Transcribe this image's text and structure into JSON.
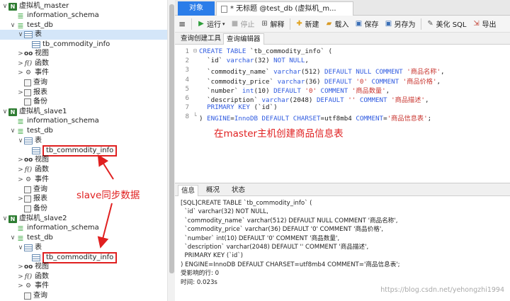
{
  "tree": {
    "items": [
      {
        "label": "虚拟机_master",
        "icon": "connection-icon",
        "chev": "∨"
      },
      {
        "label": "information_schema",
        "icon": "database-icon",
        "chev": ""
      },
      {
        "label": "test_db",
        "icon": "database-icon",
        "chev": "∨"
      },
      {
        "label": "表",
        "icon": "tables-icon",
        "chev": "∨"
      },
      {
        "label": "tb_commodity_info",
        "icon": "table-icon",
        "chev": ""
      },
      {
        "label": "视图",
        "icon": "view-icon",
        "chev": ">"
      },
      {
        "label": "函数",
        "icon": "function-icon",
        "chev": ">"
      },
      {
        "label": "事件",
        "icon": "event-icon",
        "chev": ">"
      },
      {
        "label": "查询",
        "icon": "query-icon",
        "chev": ""
      },
      {
        "label": "报表",
        "icon": "report-icon",
        "chev": ">"
      },
      {
        "label": "备份",
        "icon": "backup-icon",
        "chev": ""
      },
      {
        "label": "虚拟机_slave1",
        "icon": "connection-icon",
        "chev": "∨"
      },
      {
        "label": "information_schema",
        "icon": "database-icon",
        "chev": ""
      },
      {
        "label": "test_db",
        "icon": "database-icon",
        "chev": "∨"
      },
      {
        "label": "表",
        "icon": "tables-icon",
        "chev": "∨"
      },
      {
        "label": "tb_commodity_info",
        "icon": "table-icon",
        "chev": ""
      },
      {
        "label": "视图",
        "icon": "view-icon",
        "chev": ">"
      },
      {
        "label": "函数",
        "icon": "function-icon",
        "chev": ">"
      },
      {
        "label": "事件",
        "icon": "event-icon",
        "chev": ">"
      },
      {
        "label": "查询",
        "icon": "query-icon",
        "chev": ""
      },
      {
        "label": "报表",
        "icon": "report-icon",
        "chev": ">"
      },
      {
        "label": "备份",
        "icon": "backup-icon",
        "chev": ""
      },
      {
        "label": "虚拟机_slave2",
        "icon": "connection-icon",
        "chev": "∨"
      },
      {
        "label": "information_schema",
        "icon": "database-icon",
        "chev": ""
      },
      {
        "label": "test_db",
        "icon": "database-icon",
        "chev": "∨"
      },
      {
        "label": "表",
        "icon": "tables-icon",
        "chev": "∨"
      },
      {
        "label": "tb_commodity_info",
        "icon": "table-icon",
        "chev": ""
      },
      {
        "label": "视图",
        "icon": "view-icon",
        "chev": ">"
      },
      {
        "label": "函数",
        "icon": "function-icon",
        "chev": ">"
      },
      {
        "label": "事件",
        "icon": "event-icon",
        "chev": ">"
      },
      {
        "label": "查询",
        "icon": "query-icon",
        "chev": ""
      }
    ]
  },
  "annotations": {
    "slave_sync": "slave同步数据",
    "master_create": "在master主机创建商品信息表"
  },
  "tabs": {
    "object": "对象",
    "query": "* 无标题 @test_db (虚拟机_m..."
  },
  "toolbar": {
    "run": "运行",
    "stop": "停止",
    "explain": "解释",
    "new": "新建",
    "load": "载入",
    "save": "保存",
    "save_as": "另存为",
    "beautify": "美化 SQL",
    "export": "导出"
  },
  "subtabs": {
    "builder": "查询创建工具",
    "editor": "查询编辑器"
  },
  "code_lines": [
    {
      "n": "1",
      "tokens": [
        [
          "kw",
          "CREATE TABLE "
        ],
        [
          "id",
          "`tb_commodity_info` ("
        ]
      ]
    },
    {
      "n": "2",
      "tokens": [
        [
          "id",
          "  `id` "
        ],
        [
          "kw",
          "varchar"
        ],
        [
          "id",
          "(32) "
        ],
        [
          "kw",
          "NOT NULL"
        ],
        [
          "id",
          ","
        ]
      ]
    },
    {
      "n": "3",
      "tokens": [
        [
          "id",
          "  `commodity_name` "
        ],
        [
          "kw",
          "varchar"
        ],
        [
          "id",
          "(512) "
        ],
        [
          "kw",
          "DEFAULT NULL COMMENT "
        ],
        [
          "str",
          "'商品名称'"
        ],
        [
          "id",
          ","
        ]
      ]
    },
    {
      "n": "4",
      "tokens": [
        [
          "id",
          "  `commodity_price` "
        ],
        [
          "kw",
          "varchar"
        ],
        [
          "id",
          "(36) "
        ],
        [
          "kw",
          "DEFAULT "
        ],
        [
          "str",
          "'0' "
        ],
        [
          "kw",
          "COMMENT "
        ],
        [
          "str",
          "'商品价格'"
        ],
        [
          "id",
          ","
        ]
      ]
    },
    {
      "n": "5",
      "tokens": [
        [
          "id",
          "  `number` "
        ],
        [
          "kw",
          "int"
        ],
        [
          "id",
          "(10) "
        ],
        [
          "kw",
          "DEFAULT "
        ],
        [
          "str",
          "'0' "
        ],
        [
          "kw",
          "COMMENT "
        ],
        [
          "str",
          "'商品数量'"
        ],
        [
          "id",
          ","
        ]
      ]
    },
    {
      "n": "6",
      "tokens": [
        [
          "id",
          "  `description` "
        ],
        [
          "kw",
          "varchar"
        ],
        [
          "id",
          "(2048) "
        ],
        [
          "kw",
          "DEFAULT "
        ],
        [
          "str",
          "'' "
        ],
        [
          "kw",
          "COMMENT "
        ],
        [
          "str",
          "'商品描述'"
        ],
        [
          "id",
          ","
        ]
      ]
    },
    {
      "n": "7",
      "tokens": [
        [
          "kw",
          "  PRIMARY KEY "
        ],
        [
          "id",
          "(`id`)"
        ]
      ]
    },
    {
      "n": "8",
      "tokens": [
        [
          "id",
          ") "
        ],
        [
          "kw",
          "ENGINE"
        ],
        [
          "id",
          "="
        ],
        [
          "kw",
          "InnoDB DEFAULT CHARSET"
        ],
        [
          "id",
          "=utf8mb4 "
        ],
        [
          "kw",
          "COMMENT"
        ],
        [
          "id",
          "="
        ],
        [
          "str",
          "'商品信息表'"
        ],
        [
          "id",
          ";"
        ]
      ]
    }
  ],
  "bottom_tabs": {
    "info": "信息",
    "overview": "概况",
    "status": "状态"
  },
  "messages": [
    "[SQL]CREATE TABLE `tb_commodity_info` (",
    "  `id` varchar(32) NOT NULL,",
    "  `commodity_name` varchar(512) DEFAULT NULL COMMENT '商品名称',",
    "  `commodity_price` varchar(36) DEFAULT '0' COMMENT '商品价格',",
    "  `number` int(10) DEFAULT '0' COMMENT '商品数量',",
    "  `description` varchar(2048) DEFAULT '' COMMENT '商品描述',",
    "  PRIMARY KEY (`id`)",
    ") ENGINE=InnoDB DEFAULT CHARSET=utf8mb4 COMMENT='商品信息表';",
    "受影响的行: 0",
    "时间: 0.023s"
  ],
  "watermark": "https://blog.csdn.net/yehongzhi1994",
  "colors": {
    "accent_blue": "#2b7de9",
    "annotation_red": "#e02020",
    "keyword_blue": "#2f5be0",
    "string_red": "#c8342e"
  }
}
